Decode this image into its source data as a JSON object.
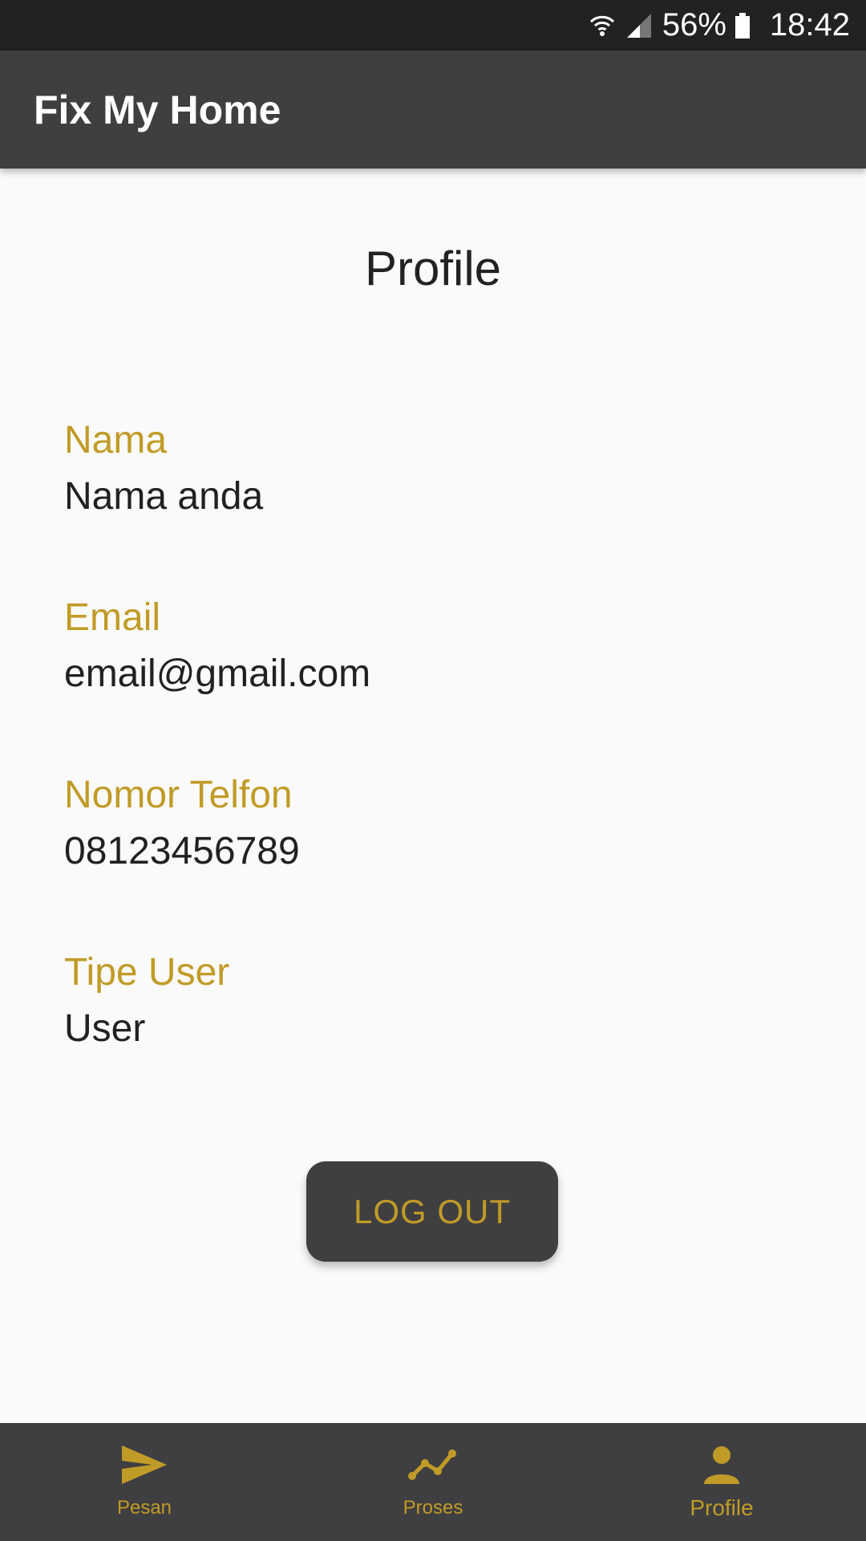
{
  "status_bar": {
    "battery_percent": "56%",
    "time": "18:42",
    "icons": [
      "wifi-icon",
      "cell-signal-icon",
      "battery-icon"
    ]
  },
  "app_bar": {
    "title": "Fix My Home"
  },
  "page": {
    "title": "Profile"
  },
  "profile": {
    "fields": [
      {
        "label": "Nama",
        "value": "Nama anda"
      },
      {
        "label": "Email",
        "value": "email@gmail.com"
      },
      {
        "label": "Nomor Telfon",
        "value": "08123456789"
      },
      {
        "label": "Tipe User",
        "value": "User"
      }
    ]
  },
  "logout_button": {
    "label": "LOG OUT"
  },
  "bottom_nav": {
    "items": [
      {
        "label": "Pesan",
        "icon": "send-icon",
        "active": false
      },
      {
        "label": "Proses",
        "icon": "trending-icon",
        "active": false
      },
      {
        "label": "Profile",
        "icon": "person-icon",
        "active": true
      }
    ]
  },
  "colors": {
    "accent": "#c19b27",
    "bar_background": "#3f3f41",
    "status_bar": "#222223",
    "page_background": "#fafafa"
  }
}
